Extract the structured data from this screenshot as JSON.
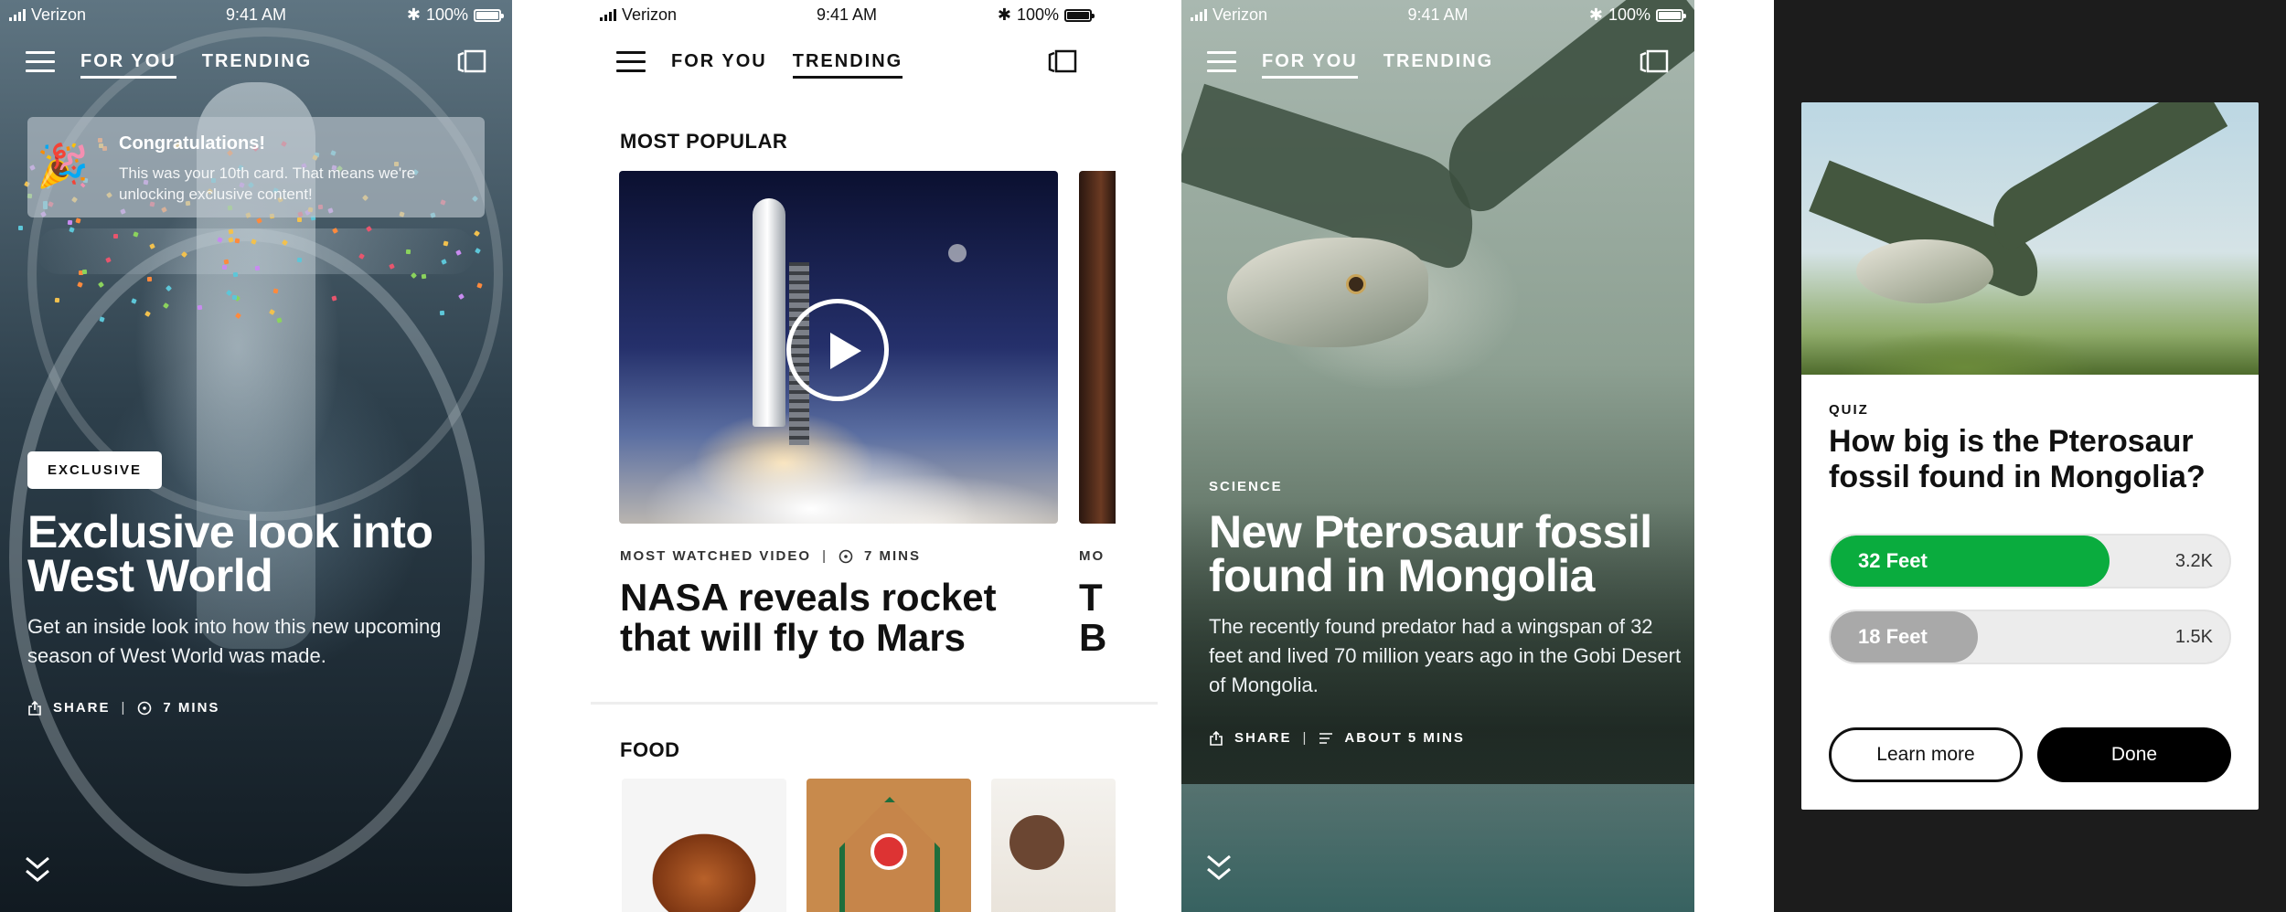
{
  "status": {
    "carrier": "Verizon",
    "time": "9:41 AM",
    "battery": "100%"
  },
  "nav": {
    "tab_for_you": "FOR YOU",
    "tab_trending": "TRENDING"
  },
  "screen1": {
    "toast_title": "Congratulations!",
    "toast_body": "This was your 10th card. That means we're unlocking exclusive content!",
    "tag": "EXCLUSIVE",
    "headline": "Exclusive look into West World",
    "dek": "Get an inside look into how this new upcoming season of West World was made.",
    "share": "SHARE",
    "sep": "|",
    "duration": "7 MINS"
  },
  "screen2": {
    "section_popular": "MOST POPULAR",
    "kicker": "MOST WATCHED VIDEO",
    "sep": "|",
    "duration": "7 MINS",
    "title": "NASA reveals rocket that will fly to Mars",
    "peek_kicker": "MO",
    "peek_title": "T\nB",
    "section_food": "FOOD"
  },
  "screen3": {
    "tag": "SCIENCE",
    "headline": "New Pterosaur fossil found in Mongolia",
    "dek": "The recently found predator had a wingspan of 32 feet and lived 70 million years ago in the Gobi Desert of Mongolia.",
    "share": "SHARE",
    "sep": "|",
    "duration": "ABOUT 5 MINS"
  },
  "quiz": {
    "label": "QUIZ",
    "question": "How big is the Pterosaur fossil found in Mongolia?",
    "options": [
      {
        "label": "32 Feet",
        "count": "3.2K",
        "share": 0.7,
        "color": "#0aac3e"
      },
      {
        "label": "18 Feet",
        "count": "1.5K",
        "share": 0.37,
        "color": "#a9a9a9"
      }
    ],
    "learn_more": "Learn more",
    "done": "Done"
  },
  "icons": [
    "signal-icon",
    "bluetooth-icon",
    "battery-icon",
    "menu-icon",
    "cards-icon",
    "party-popper-icon",
    "share-icon",
    "clock-icon",
    "play-icon",
    "chevron-down-icon",
    "article-icon"
  ]
}
